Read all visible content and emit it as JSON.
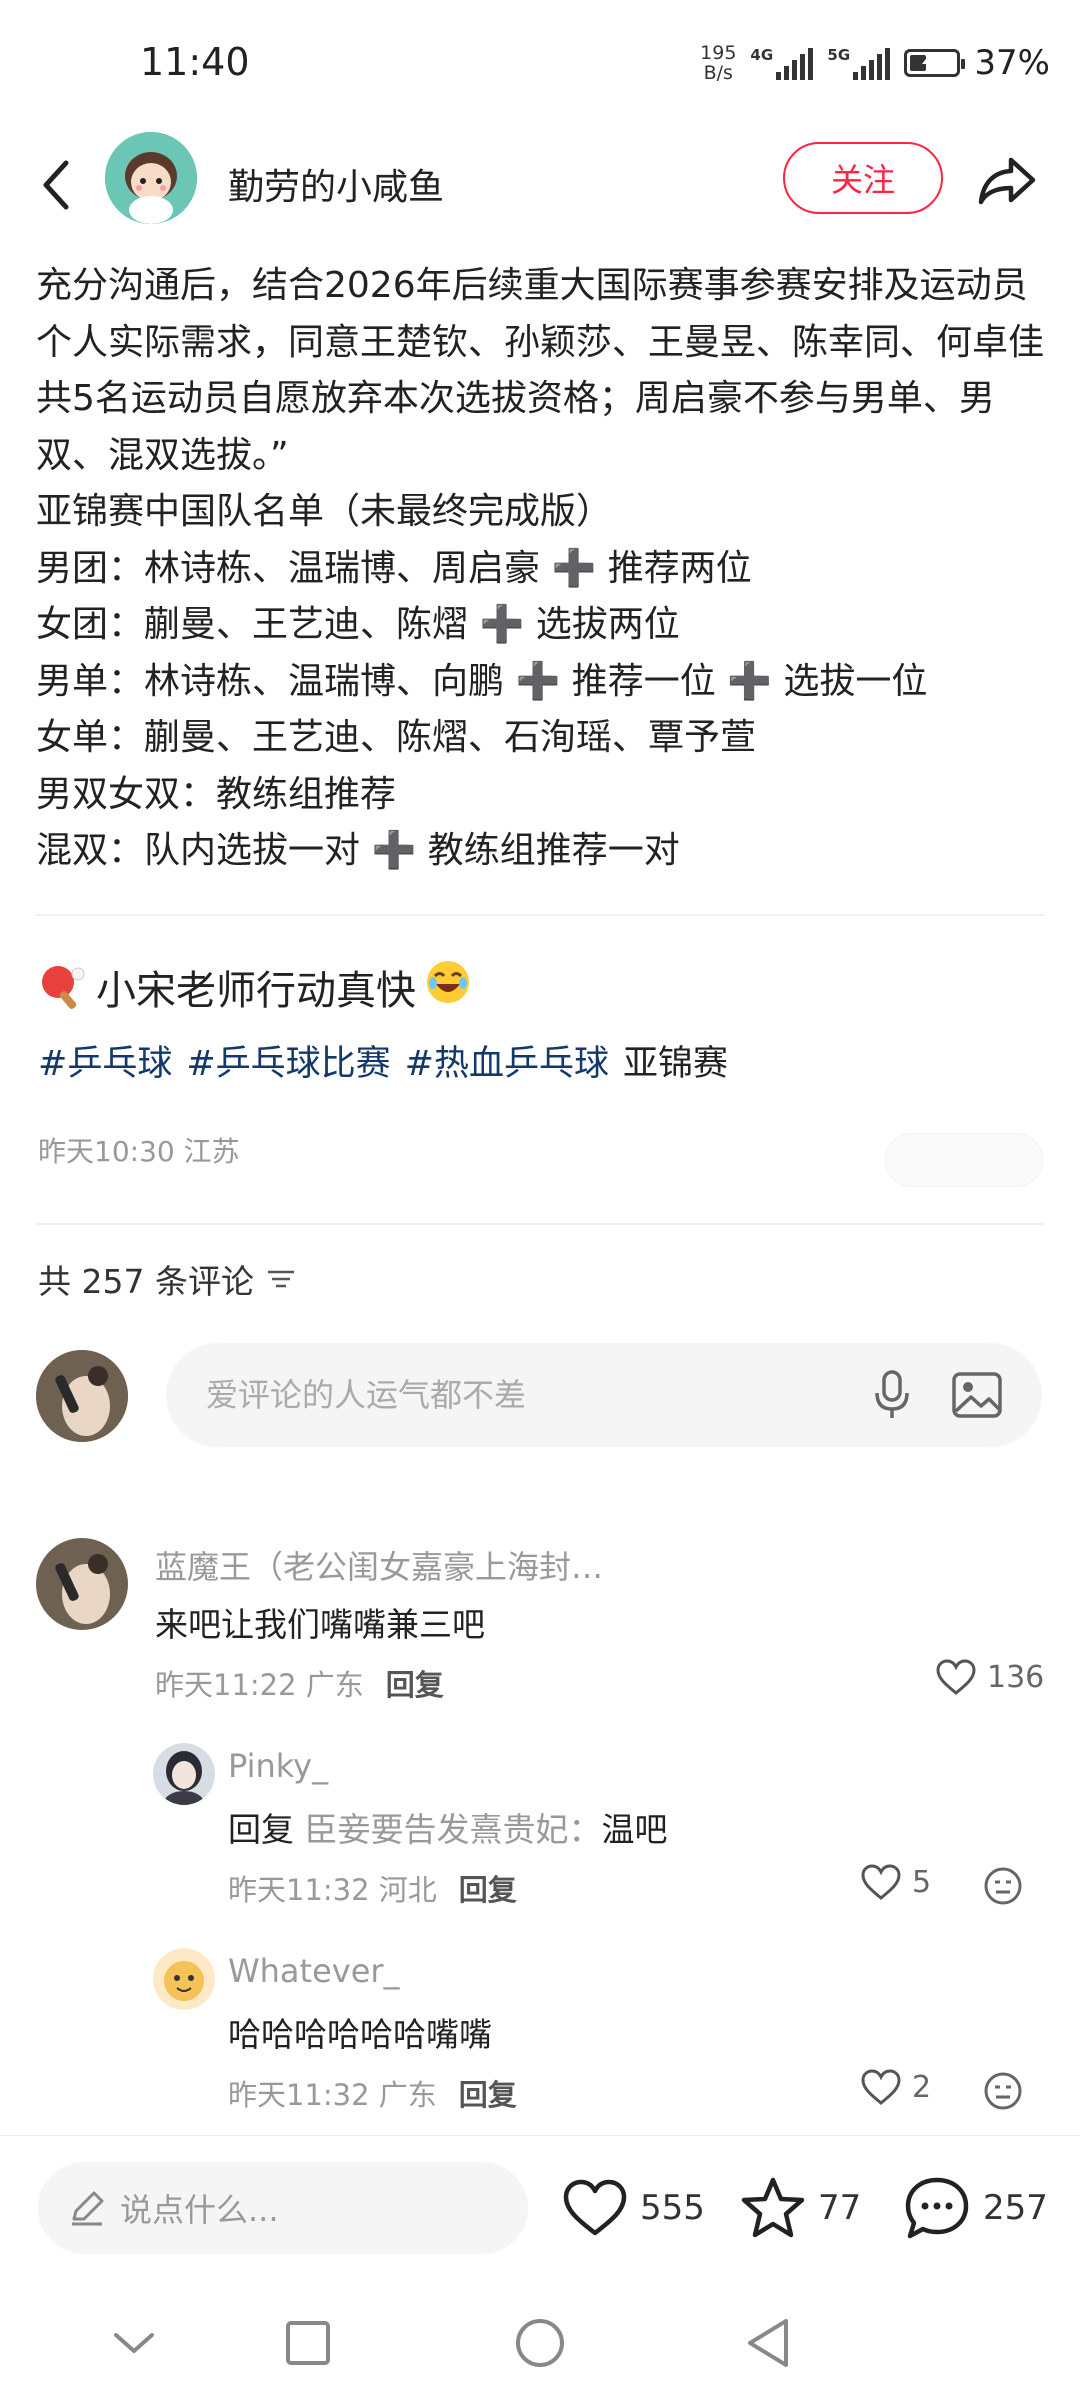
{
  "status_bar": {
    "time": "11:40",
    "net_speed_value": "195",
    "net_speed_unit": "B/s",
    "sig1": "4G",
    "sig2": "5G",
    "battery_pct": "37%",
    "battery_level": 0.37
  },
  "header": {
    "author_name": "勤劳的小咸鱼",
    "follow_label": "关注"
  },
  "post": {
    "lines": [
      "充分沟通后，结合2026年后续重大国际赛事参赛安排及运动员个人实际需求，同意王楚钦、孙颖莎、王曼昱、陈幸同、何卓佳共5名运动员自愿放弃本次选拔资格；周启豪不参与男单、男双、混双选拔。”",
      "亚锦赛中国队名单（未最终完成版）",
      "男团：林诗栋、温瑞博、周启豪 ➕ 推荐两位",
      "女团：蒯曼、王艺迪、陈熠 ➕ 选拔两位",
      "男单：林诗栋、温瑞博、向鹏 ➕ 推荐一位 ➕ 选拔一位",
      "女单：蒯曼、王艺迪、陈熠、石洵瑶、覃予萱",
      "男双女双：教练组推荐",
      "混双：队内选拔一对 ➕ 教练组推荐一对"
    ],
    "highlight": "小宋老师行动真快",
    "tags": [
      "#乒乓球",
      "#乒乓球比赛",
      "#热血乒乓球"
    ],
    "plain_tag": "亚锦赛",
    "meta": "昨天10:30 江苏"
  },
  "comments_header": {
    "count_text": "共 257 条评论"
  },
  "comment_input": {
    "placeholder": "爱评论的人运气都不差"
  },
  "comments": [
    {
      "name": "蓝魔王（老公闺女嘉豪上海封…",
      "text": "来吧让我们嘴嘴兼三吧",
      "time": "昨天11:22 广东",
      "reply": "回复",
      "likes": "136"
    },
    {
      "name": "Pinky_",
      "reply_kw": "回复",
      "reply_to": "臣妾要告发熹贵妃：",
      "text": "温吧",
      "time": "昨天11:32 河北",
      "reply": "回复",
      "likes": "5"
    },
    {
      "name": "Whatever_",
      "text": "哈哈哈哈哈哈嘴嘴",
      "time": "昨天11:32 广东",
      "reply": "回复",
      "likes": "2"
    }
  ],
  "bottom_bar": {
    "input_placeholder": "说点什么...",
    "likes": "555",
    "stars": "77",
    "comments": "257"
  },
  "icons": {
    "back": "back-arrow-icon",
    "share": "share-icon",
    "mic": "microphone-icon",
    "image": "image-icon",
    "like": "heart-icon",
    "star": "star-icon",
    "comment": "comment-bubble-icon",
    "emoji": "emoji-icon",
    "edit": "pencil-icon",
    "sort": "sort-icon"
  },
  "colors": {
    "accent": "#ff2442",
    "tag": "#13386c"
  }
}
